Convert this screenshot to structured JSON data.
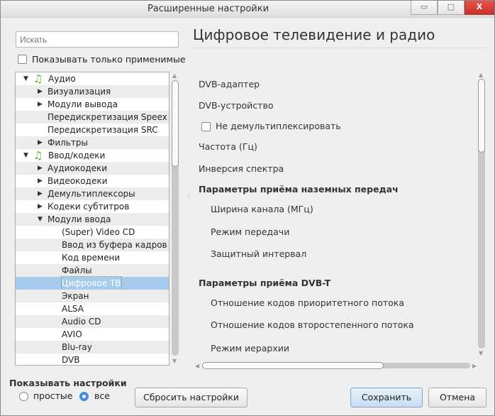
{
  "window": {
    "title": "Расширенные настройки",
    "minimize": "▭",
    "maximize": "□",
    "close": "X"
  },
  "search": {
    "placeholder": "Искать"
  },
  "only_applicable": {
    "label": "Показывать только применимые",
    "checked": false
  },
  "tree": [
    {
      "label": "Аудио",
      "level": 0,
      "arrow": "▼",
      "icon": "♫"
    },
    {
      "label": "Визуализация",
      "level": 1,
      "arrow": "▶"
    },
    {
      "label": "Модули вывода",
      "level": 1,
      "arrow": "▶"
    },
    {
      "label": "Передискретизация Speex",
      "level": 1,
      "arrow": ""
    },
    {
      "label": "Передискретизация SRC",
      "level": 1,
      "arrow": ""
    },
    {
      "label": "Фильтры",
      "level": 1,
      "arrow": "▶"
    },
    {
      "label": "Ввод/кодеки",
      "level": 0,
      "arrow": "▼",
      "icon": "♫"
    },
    {
      "label": "Аудиокодеки",
      "level": 1,
      "arrow": "▶"
    },
    {
      "label": "Видеокодеки",
      "level": 1,
      "arrow": "▶"
    },
    {
      "label": "Демультиплексоры",
      "level": 1,
      "arrow": "▶"
    },
    {
      "label": "Кодеки субтитров",
      "level": 1,
      "arrow": "▶"
    },
    {
      "label": "Модули ввода",
      "level": 1,
      "arrow": "▼"
    },
    {
      "label": "(Super) Video CD",
      "level": 2,
      "arrow": ""
    },
    {
      "label": "Ввод из буфера кадров",
      "level": 2,
      "arrow": ""
    },
    {
      "label": "Код времени",
      "level": 2,
      "arrow": ""
    },
    {
      "label": "Файлы",
      "level": 2,
      "arrow": ""
    },
    {
      "label": "Цифровое ТВ",
      "level": 2,
      "arrow": "",
      "selected": true
    },
    {
      "label": "Экран",
      "level": 2,
      "arrow": ""
    },
    {
      "label": "ALSA",
      "level": 2,
      "arrow": ""
    },
    {
      "label": "Audio CD",
      "level": 2,
      "arrow": ""
    },
    {
      "label": "AVIO",
      "level": 2,
      "arrow": ""
    },
    {
      "label": "Blu-ray",
      "level": 2,
      "arrow": ""
    },
    {
      "label": "DVB",
      "level": 2,
      "arrow": ""
    }
  ],
  "panel": {
    "title": "Цифровое телевидение и радио",
    "options": [
      {
        "label": "DVB-адаптер",
        "type": "text",
        "indent": 0
      },
      {
        "label": "DVB-устройство",
        "type": "text",
        "indent": 0
      },
      {
        "label": "Не демультиплексировать",
        "type": "checkbox",
        "indent": 0,
        "checked": false
      },
      {
        "label": "Частота (Гц)",
        "type": "text",
        "indent": 0
      },
      {
        "label": "Инверсия спектра",
        "type": "text",
        "indent": 0
      },
      {
        "label": "Параметры приёма наземных передач",
        "type": "section",
        "indent": 0
      },
      {
        "label": "Ширина канала (МГц)",
        "type": "text",
        "indent": 1
      },
      {
        "label": "Режим передачи",
        "type": "text",
        "indent": 1
      },
      {
        "label": "Защитный интервал",
        "type": "text",
        "indent": 1
      },
      {
        "label": "Параметры приёма DVB-T",
        "type": "section",
        "indent": 0
      },
      {
        "label": "Отношение кодов приоритетного потока",
        "type": "text",
        "indent": 1
      },
      {
        "label": "Отношение кодов второстепенного потока",
        "type": "text",
        "indent": 1
      },
      {
        "label": "Режим иерархии",
        "type": "text",
        "indent": 1
      }
    ]
  },
  "show_settings": {
    "label": "Показывать настройки",
    "simple": "простые",
    "all": "все",
    "selected": "все"
  },
  "buttons": {
    "reset": "Сбросить настройки",
    "save": "Сохранить",
    "cancel": "Отмена"
  }
}
